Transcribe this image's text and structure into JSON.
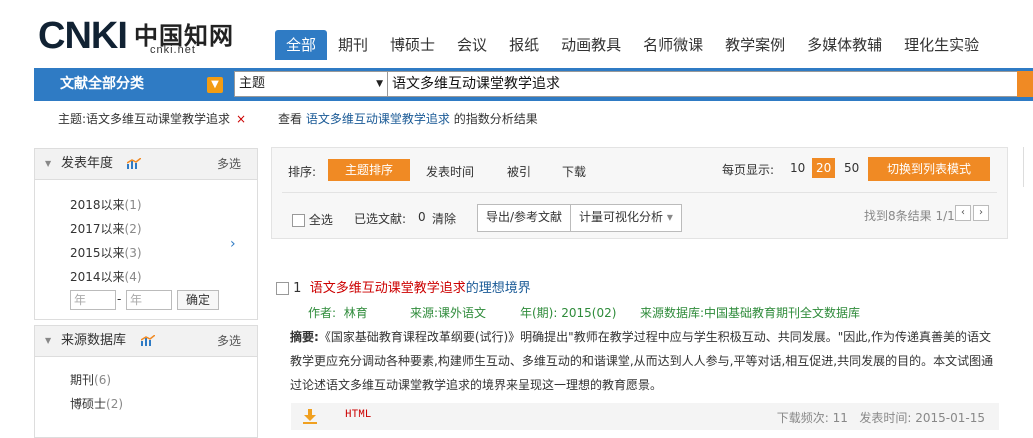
{
  "logo": {
    "wordmark": "CNKI",
    "cn_name": "中国知网",
    "domain": "cnki.net"
  },
  "nav": [
    "全部",
    "期刊",
    "博硕士",
    "会议",
    "报纸",
    "动画教具",
    "名师微课",
    "教学案例",
    "多媒体教辅",
    "理化生实验"
  ],
  "search": {
    "category_label": "文献全部分类",
    "field": "主题",
    "query": "语文多维互动课堂教学追求"
  },
  "crumb": {
    "label": "主题:语文多维互动课堂教学追求",
    "remove": "×"
  },
  "index_link": {
    "prefix": "查看",
    "keyword": "语文多维互动课堂教学追求",
    "suffix": "的指数分析结果"
  },
  "year_panel": {
    "title": "发表年度",
    "multi": "多选",
    "items": [
      {
        "label": "2018以来",
        "count": "(1)"
      },
      {
        "label": "2017以来",
        "count": "(2)"
      },
      {
        "label": "2015以来",
        "count": "(3)"
      },
      {
        "label": "2014以来",
        "count": "(4)"
      }
    ],
    "year_placeholder": "年",
    "dash": "-",
    "confirm": "确定"
  },
  "source_panel": {
    "title": "来源数据库",
    "multi": "多选",
    "items": [
      {
        "label": "期刊",
        "count": "(6)"
      },
      {
        "label": "博硕士",
        "count": "(2)"
      }
    ]
  },
  "toolbar": {
    "sort_label": "排序:",
    "sort_active": "主题排序",
    "sort_date": "发表时间",
    "sort_cite": "被引",
    "sort_download": "下载",
    "per_page_label": "每页显示:",
    "per_page": [
      "10",
      "20",
      "50"
    ],
    "per_page_active": "20",
    "list_mode": "切换到列表模式",
    "select_all": "全选",
    "selected_label": "已选文献:",
    "selected_count": "0",
    "clear": "清除",
    "export": "导出/参考文献",
    "viz": "计量可视化分析",
    "viz_arrow": "▾",
    "found": "找到8条结果 1/1",
    "prev": "‹",
    "next": "›"
  },
  "result": {
    "index": "1",
    "title_hit": "语文多维互动课堂教学追求",
    "title_rest": "的理想境界",
    "author_label": "作者:",
    "author": "林育",
    "source_label": "来源:",
    "source": "课外语文",
    "year_label": "年(期):",
    "year": "2015(02)",
    "db_label": "来源数据库:",
    "db": "中国基础教育期刊全文数据库",
    "abstract_label": "摘要:",
    "abstract": "《国家基础教育课程改革纲要(试行)》明确提出\"教师在教学过程中应与学生积极互动、共同发展。\"因此,作为传递真善美的语文教学更应充分调动各种要素,构建师生互动、多维互动的和谐课堂,从而达到人人参与,平等对话,相互促进,共同发展的目的。本文试图通过论述语文多维互动课堂教学追求的境界来呈现这一理想的教育愿景。",
    "format": "HTML",
    "download_label": "下载频次:",
    "download_count": "11",
    "date_label": "发表时间:",
    "date": "2015-01-15"
  },
  "colors": {
    "primary": "#2f7bc4",
    "accent": "#f08a24",
    "hit": "#cc0000",
    "meta": "#2e8b3a"
  }
}
